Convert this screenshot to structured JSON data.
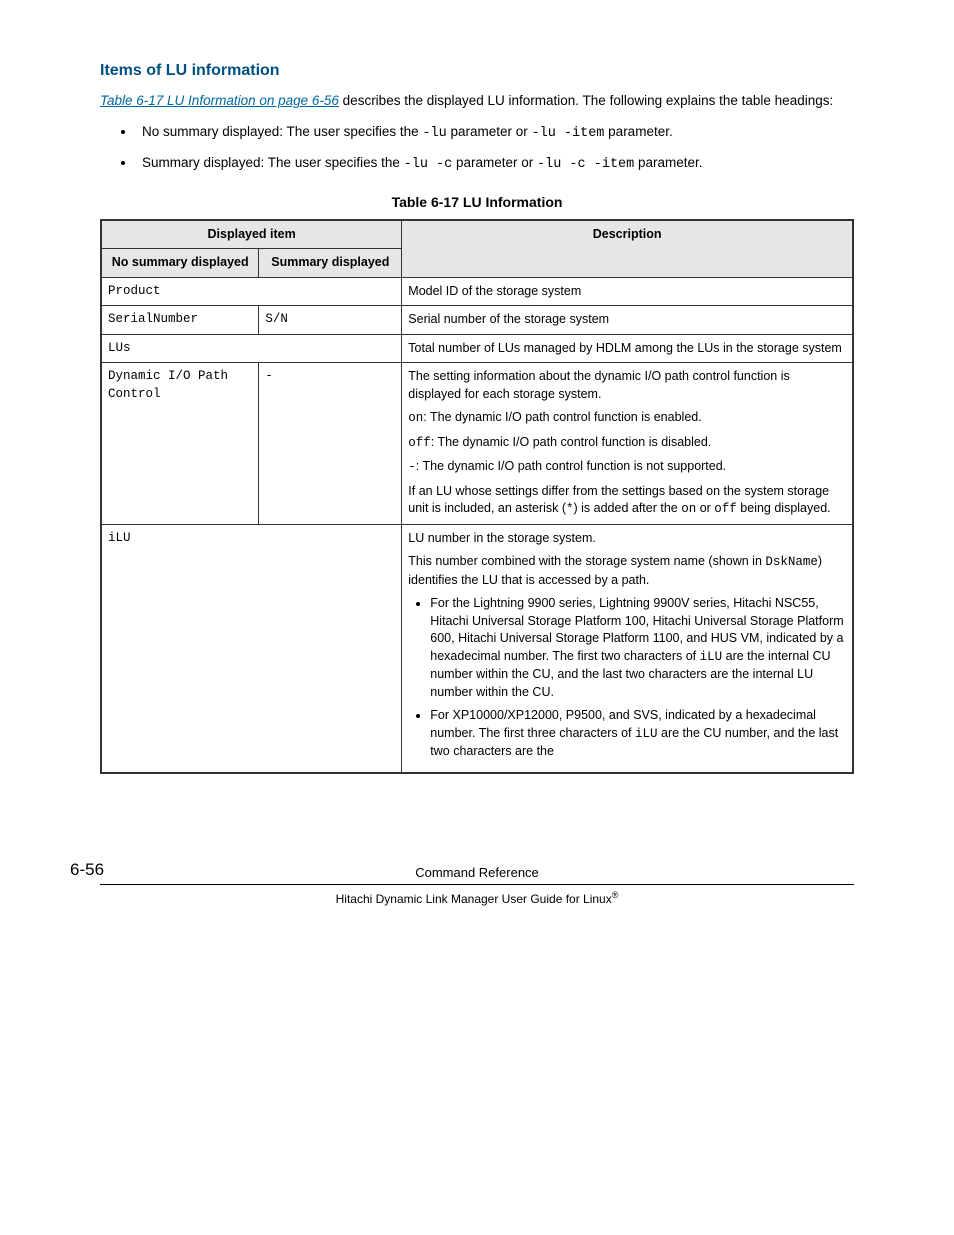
{
  "section": {
    "heading": "Items of LU information",
    "intro_link": "Table 6-17 LU Information on page 6-56",
    "intro_rest": " describes the displayed LU information. The following explains the table headings:"
  },
  "bullets": {
    "b1_pre": "No summary displayed: The user specifies the ",
    "b1_c1": "-lu",
    "b1_mid": " parameter or ",
    "b1_c2": "-lu -item",
    "b1_post": " parameter.",
    "b2_pre": "Summary displayed: The user specifies the ",
    "b2_c1": "-lu -c",
    "b2_mid": " parameter or ",
    "b2_c2": "-lu -c -item",
    "b2_post": " parameter."
  },
  "table": {
    "caption": "Table 6-17 LU Information",
    "head_group": "Displayed item",
    "head_nosum": "No summary displayed",
    "head_sum": "Summary displayed",
    "head_desc": "Description",
    "r1_nosum": "Product",
    "r1_desc": "Model ID of the storage system",
    "r2_nosum": "SerialNumber",
    "r2_sum": "S/N",
    "r2_desc": "Serial number of the storage system",
    "r3_nosum": "LUs",
    "r3_desc": "Total number of LUs managed by HDLM among the LUs in the storage system",
    "r4_nosum": "Dynamic I/O Path Control",
    "r4_sum": "-",
    "r4_p1": "The setting information about the dynamic I/O path control function is displayed for each storage system.",
    "r4_on": "on",
    "r4_on_txt": ": The dynamic I/O path control function is enabled.",
    "r4_off": "off",
    "r4_off_txt": ": The dynamic I/O path control function is disabled.",
    "r4_dash": "-",
    "r4_dash_txt": ": The dynamic I/O path control function is not supported.",
    "r4_p5a": "If an LU whose settings differ from the settings based on the system storage unit is included, an asterisk (",
    "r4_ast": "*",
    "r4_p5b": ") is added after the ",
    "r4_p5c": " or ",
    "r4_p5d": " being displayed.",
    "r5_nosum": "iLU",
    "r5_p1": "LU number in the storage system.",
    "r5_p2a": "This number combined with the storage system name (shown in ",
    "r5_dsk": "DskName",
    "r5_p2b": ") identifies the LU that is accessed by a path.",
    "r5_li1a": "For the Lightning 9900 series, Lightning 9900V series, Hitachi NSC55, Hitachi Universal Storage Platform 100, Hitachi Universal Storage Platform 600, Hitachi Universal Storage Platform 1100, and HUS VM, indicated by a hexadecimal number. The first two characters of ",
    "r5_li1_ilu": "iLU",
    "r5_li1b": " are the internal CU number within the CU, and the last two characters are the internal LU number within the CU.",
    "r5_li2a": "For XP10000/XP12000, P9500, and SVS, indicated by a hexadecimal number. The first three characters of ",
    "r5_li2_ilu": "iLU",
    "r5_li2b": " are the CU number, and the last two characters are the"
  },
  "footer": {
    "page": "6-56",
    "title": "Command Reference",
    "sub": "Hitachi Dynamic Link Manager User Guide for Linux"
  }
}
